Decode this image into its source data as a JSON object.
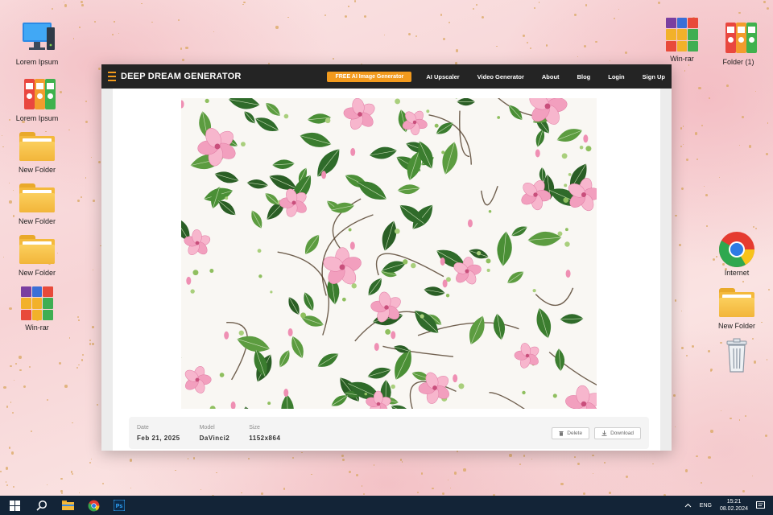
{
  "desktop": {
    "left_icons": [
      {
        "label": "Lorem Ipsum",
        "icon": "computer-icon"
      },
      {
        "label": "Lorem Ipsum",
        "icon": "binders-icon"
      },
      {
        "label": "New Folder",
        "icon": "folder-icon"
      },
      {
        "label": "New Folder",
        "icon": "folder-icon"
      },
      {
        "label": "New Folder",
        "icon": "folder-icon"
      },
      {
        "label": "Win-rar",
        "icon": "winrar-icon"
      }
    ],
    "right_icons": [
      {
        "label": "Win-rar",
        "icon": "winrar-icon"
      },
      {
        "label": "Folder (1)",
        "icon": "binders-icon"
      },
      {
        "label": "Internet",
        "icon": "chrome-icon"
      },
      {
        "label": "New Folder",
        "icon": "folder-icon"
      },
      {
        "label": "",
        "icon": "recycle-bin-icon"
      }
    ]
  },
  "app": {
    "brand": "DEEP DREAM GENERATOR",
    "cta": "FREE AI Image Generator",
    "nav": [
      "AI Upscaler",
      "Video Generator",
      "About",
      "Blog",
      "Login",
      "Sign Up"
    ],
    "meta": {
      "date_label": "Date",
      "date_value": "Feb 21, 2025",
      "model_label": "Model",
      "model_value": "DaVinci2",
      "size_label": "Size",
      "size_value": "1152x864",
      "delete_label": "Delete",
      "download_label": "Download"
    }
  },
  "taskbar": {
    "language": "ENG",
    "time": "15:21",
    "date": "08.02.2024"
  },
  "colors": {
    "accent": "#f29a1d",
    "navbar": "#242424",
    "taskbar": "#132437"
  }
}
